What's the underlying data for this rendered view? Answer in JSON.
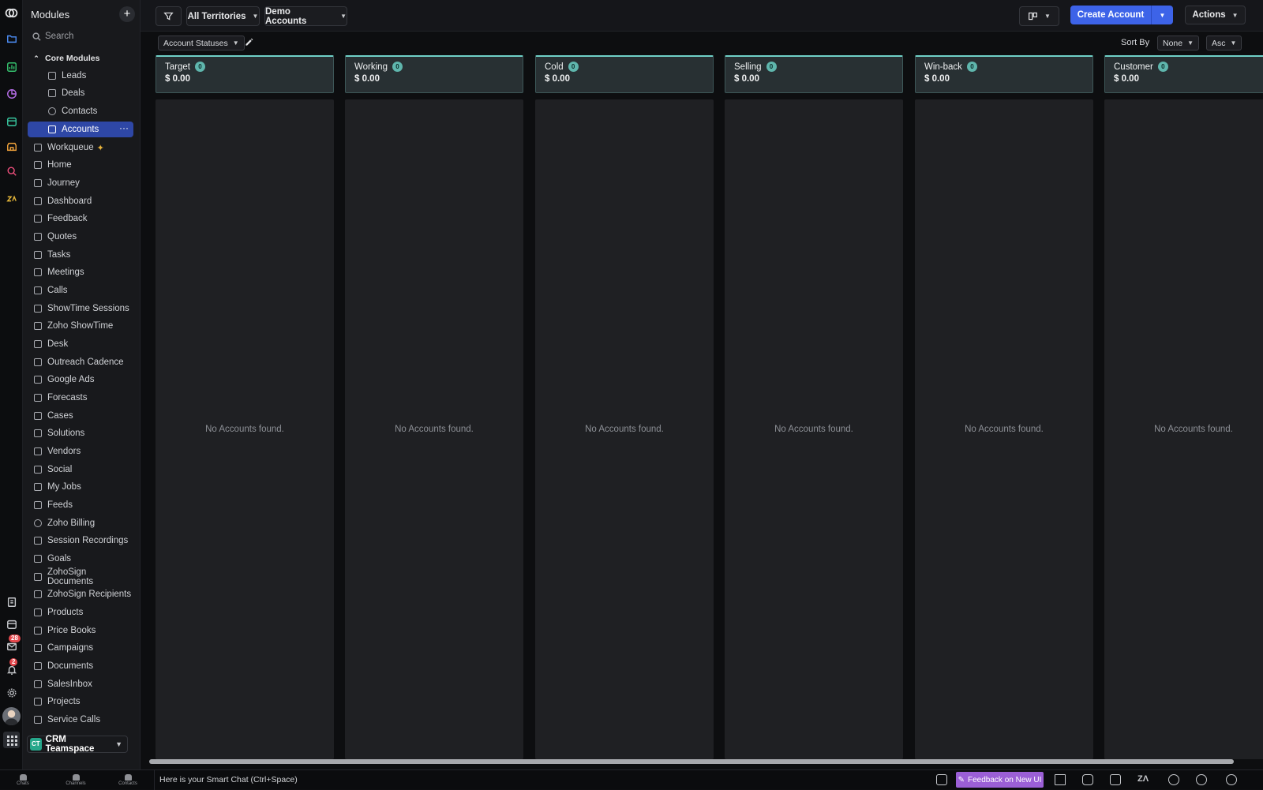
{
  "sidebar": {
    "title": "Modules",
    "add_label": "+",
    "search_placeholder": "Search",
    "core_modules_label": "Core Modules",
    "core_items": [
      {
        "label": "Leads"
      },
      {
        "label": "Deals"
      },
      {
        "label": "Contacts"
      },
      {
        "label": "Accounts",
        "active": true
      }
    ],
    "items": [
      {
        "label": "Workqueue"
      },
      {
        "label": "Home"
      },
      {
        "label": "Journey"
      },
      {
        "label": "Dashboard"
      },
      {
        "label": "Feedback"
      },
      {
        "label": "Quotes"
      },
      {
        "label": "Tasks"
      },
      {
        "label": "Meetings"
      },
      {
        "label": "Calls"
      },
      {
        "label": "ShowTime Sessions"
      },
      {
        "label": "Zoho ShowTime"
      },
      {
        "label": "Desk"
      },
      {
        "label": "Outreach Cadence"
      },
      {
        "label": "Google Ads"
      },
      {
        "label": "Forecasts"
      },
      {
        "label": "Cases"
      },
      {
        "label": "Solutions"
      },
      {
        "label": "Vendors"
      },
      {
        "label": "Social"
      },
      {
        "label": "My Jobs"
      },
      {
        "label": "Feeds"
      },
      {
        "label": "Zoho Billing"
      },
      {
        "label": "Session Recordings"
      },
      {
        "label": "Goals"
      },
      {
        "label": "ZohoSign Documents"
      },
      {
        "label": "ZohoSign Recipients"
      },
      {
        "label": "Products"
      },
      {
        "label": "Price Books"
      },
      {
        "label": "Campaigns"
      },
      {
        "label": "Documents"
      },
      {
        "label": "SalesInbox"
      },
      {
        "label": "Projects"
      },
      {
        "label": "Service Calls"
      }
    ],
    "workspace": {
      "initials": "CT",
      "name": "CRM Teamspace"
    }
  },
  "rail": {
    "mail_badge": "28",
    "notification_badge": "2"
  },
  "toolbar": {
    "territory": "All Territories",
    "view": "Demo Accounts",
    "create_label": "Create Account",
    "actions_label": "Actions"
  },
  "subbar": {
    "status_chip": "Account Statuses",
    "sort_by_label": "Sort By",
    "sort_field": "None",
    "sort_order": "Asc"
  },
  "board": {
    "empty_text": "No Accounts found.",
    "columns": [
      {
        "title": "Target",
        "count": "0",
        "amount": "$ 0.00"
      },
      {
        "title": "Working",
        "count": "0",
        "amount": "$ 0.00"
      },
      {
        "title": "Cold",
        "count": "0",
        "amount": "$ 0.00"
      },
      {
        "title": "Selling",
        "count": "0",
        "amount": "$ 0.00"
      },
      {
        "title": "Win-back",
        "count": "0",
        "amount": "$ 0.00"
      },
      {
        "title": "Customer",
        "count": "0",
        "amount": "$ 0.00"
      }
    ]
  },
  "statusbar": {
    "tabs": [
      "Chats",
      "Channels",
      "Contacts"
    ],
    "smart_chat": "Here is your Smart Chat (Ctrl+Space)",
    "feedback_label": "Feedback on New UI"
  },
  "colors": {
    "accent": "#3d63e8",
    "active_item": "#2e47a6",
    "column_border": "#6fd0c7",
    "count_badge": "#5fb6ad",
    "feedback": "#9b5fd6"
  }
}
